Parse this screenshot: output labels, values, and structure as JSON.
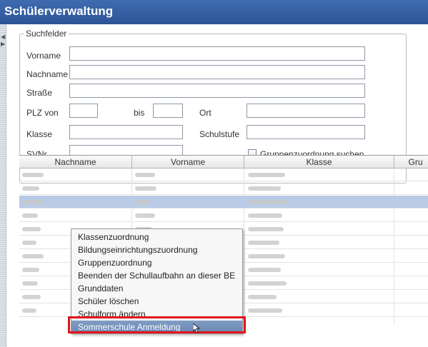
{
  "window": {
    "title": "Schülerverwaltung"
  },
  "search": {
    "legend": "Suchfelder",
    "vorname_label": "Vorname",
    "nachname_label": "Nachname",
    "strasse_label": "Straße",
    "plz_von_label": "PLZ von",
    "bis_label": "bis",
    "ort_label": "Ort",
    "klasse_label": "Klasse",
    "schulstufe_label": "Schulstufe",
    "svnr_label": "SVNr",
    "gruppen_checkbox_label": "Gruppenzuordnung suchen",
    "gruppen_checked": false,
    "values": {
      "vorname": "",
      "nachname": "",
      "strasse": "",
      "plz_von": "",
      "plz_bis": "",
      "ort": "",
      "klasse": "",
      "schulstufe": "",
      "svnr": ""
    }
  },
  "table": {
    "columns": [
      "Nachname",
      "Vorname",
      "Klasse",
      "Gru"
    ],
    "row_count": 11,
    "selected_row": 2
  },
  "context_menu": {
    "items": [
      "Klassenzuordnung",
      "Bildungseinrichtungszuordnung",
      "Gruppenzuordnung",
      "Beenden der Schullaufbahn an dieser BE",
      "Grunddaten",
      "Schüler löschen",
      "Schulform ändern",
      "Sommerschule Anmeldung"
    ],
    "highlighted_index": 7
  },
  "colors": {
    "title_bar": "#2c5597",
    "selection": "#b9cbe6",
    "menu_highlight": "#6b88b3",
    "callout": "#e0141b"
  }
}
